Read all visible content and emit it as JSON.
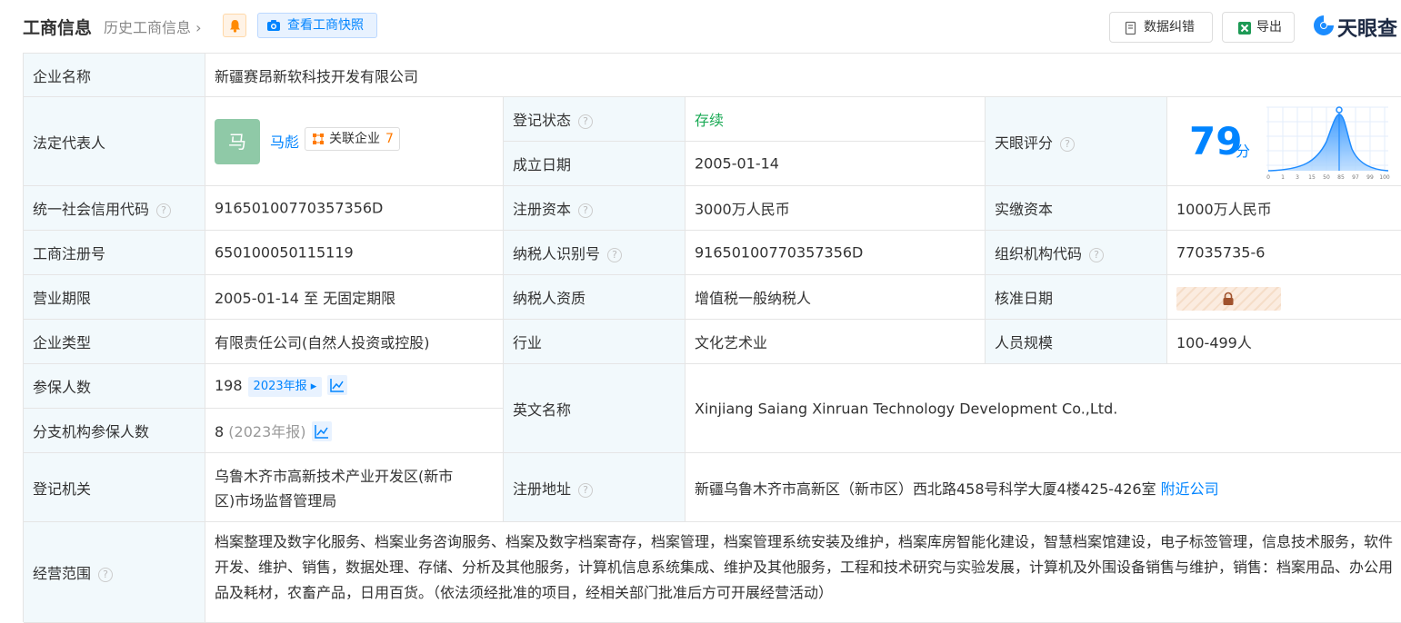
{
  "header": {
    "title": "工商信息",
    "history_link": "历史工商信息",
    "snapshot_button": "查看工商快照",
    "correction_button": "数据纠错",
    "export_button": "导出",
    "logo_text": "天眼查"
  },
  "rows": {
    "company_name": {
      "label": "企业名称",
      "value": "新疆赛昂新软科技开发有限公司"
    },
    "legal_rep": {
      "label": "法定代表人",
      "avatar_char": "马",
      "name": "马彪",
      "related_label": "关联企业",
      "related_count": "7"
    },
    "reg_status": {
      "label": "登记状态",
      "value": "存续"
    },
    "established": {
      "label": "成立日期",
      "value": "2005-01-14"
    },
    "score": {
      "label": "天眼评分",
      "value": "79",
      "unit": "分",
      "ticks": [
        "0",
        "1",
        "3",
        "15",
        "50",
        "85",
        "97",
        "99",
        "100"
      ]
    },
    "credit_code": {
      "label": "统一社会信用代码",
      "value": "91650100770357356D"
    },
    "reg_capital": {
      "label": "注册资本",
      "value": "3000万人民币"
    },
    "paid_capital": {
      "label": "实缴资本",
      "value": "1000万人民币"
    },
    "reg_number": {
      "label": "工商注册号",
      "value": "650100050115119"
    },
    "taxpayer_id": {
      "label": "纳税人识别号",
      "value": "91650100770357356D"
    },
    "org_code": {
      "label": "组织机构代码",
      "value": "77035735-6"
    },
    "business_term": {
      "label": "营业期限",
      "value": "2005-01-14 至 无固定期限"
    },
    "taxpayer_qual": {
      "label": "纳税人资质",
      "value": "增值税一般纳税人"
    },
    "approval_date": {
      "label": "核准日期"
    },
    "company_type": {
      "label": "企业类型",
      "value": "有限责任公司(自然人投资或控股)"
    },
    "industry": {
      "label": "行业",
      "value": "文化艺术业"
    },
    "staff_size": {
      "label": "人员规模",
      "value": "100-499人"
    },
    "insured": {
      "label": "参保人数",
      "value": "198",
      "year_tag": "2023年报"
    },
    "branch_insured": {
      "label": "分支机构参保人数",
      "value": "8",
      "year_note": "(2023年报)"
    },
    "english_name": {
      "label": "英文名称",
      "value": "Xinjiang Saiang Xinruan Technology Development Co.,Ltd."
    },
    "reg_authority": {
      "label": "登记机关",
      "line1": "乌鲁木齐市高新技术产业开发区(新市",
      "line2": "区)市场监督管理局"
    },
    "reg_address": {
      "label": "注册地址",
      "value": "新疆乌鲁木齐市高新区（新市区）西北路458号科学大厦4楼425-426室",
      "nearby_link": "附近公司"
    },
    "business_scope": {
      "label": "经营范围",
      "value": "档案整理及数字化服务、档案业务咨询服务、档案及数字档案寄存，档案管理，档案管理系统安装及维护，档案库房智能化建设，智慧档案馆建设，电子标签管理，信息技术服务，软件开发、维护、销售，数据处理、存储、分析及其他服务，计算机信息系统集成、维护及其他服务，工程和技术研究与实验发展，计算机及外围设备销售与维护，销售：档案用品、办公用品及耗材，农畜产品，日用百货。（依法须经批准的项目，经相关部门批准后方可开展经营活动）"
    }
  },
  "colors": {
    "accent": "#0084ff",
    "label_bg": "#f2f9fc",
    "status_green": "#1aaa55",
    "count_orange": "#ff7a00"
  }
}
